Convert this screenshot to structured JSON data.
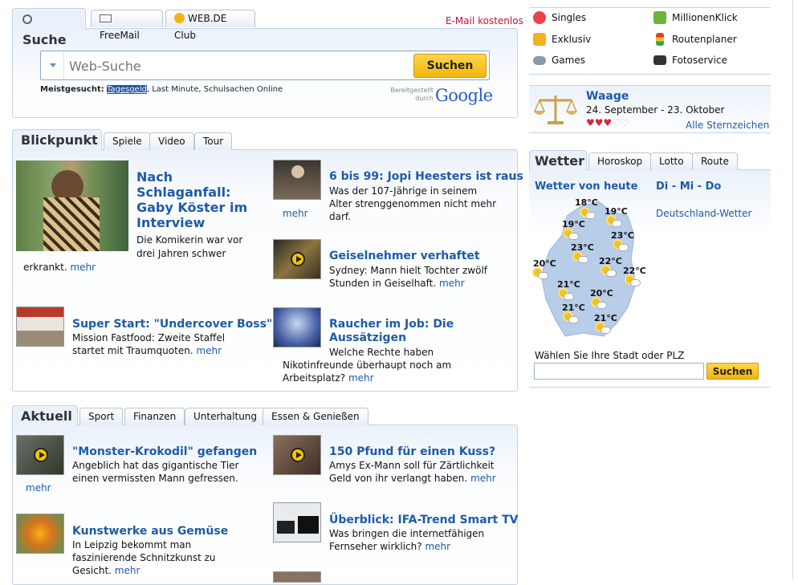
{
  "search": {
    "tabs": [
      {
        "label": "Suche"
      },
      {
        "label": "FreeMail"
      },
      {
        "label": "WEB.DE Club"
      }
    ],
    "email_link": "E-Mail kostenlos",
    "placeholder": "Web-Suche",
    "button": "Suchen",
    "meistgesucht_label": "Meistgesucht:",
    "meistgesucht_1": "Tagesgeld",
    "meistgesucht_rest": ", Last Minute, Schulsachen Online",
    "provided_by": "Bereitgestellt durch",
    "google": "Google"
  },
  "blickpunkt": {
    "tabs": [
      {
        "label": "Blickpunkt"
      },
      {
        "label": "Spiele"
      },
      {
        "label": "Video"
      },
      {
        "label": "Tour"
      }
    ],
    "lead": {
      "title": "Nach Schlaganfall: Gaby Köster im Interview",
      "text": "Die Komikerin war vor drei Jahren schwer",
      "text2": "erkrankt.",
      "more": "mehr"
    },
    "items": [
      {
        "title": "6 bis 99: Jopi Heesters ist raus",
        "text": "Was der 107-Jährige in seinem Alter strenggenommen nicht mehr darf.",
        "more": "mehr"
      },
      {
        "title": "Geiselnehmer verhaftet",
        "text": "Sydney: Mann hielt Tochter zwölf Stunden in Geiselhaft.",
        "more": "mehr"
      },
      {
        "title": "Super Start: \"Undercover Boss\"",
        "text": "Mission Fastfood: Zweite Staffel startet mit Traumquoten.",
        "more": "mehr"
      },
      {
        "title": "Raucher im Job: Die Aussätzigen",
        "text": "Welche Rechte haben Nikotinfreunde überhaupt noch am Arbeitsplatz?",
        "more": "mehr"
      }
    ]
  },
  "aktuell": {
    "tabs": [
      {
        "label": "Aktuell"
      },
      {
        "label": "Sport"
      },
      {
        "label": "Finanzen"
      },
      {
        "label": "Unterhaltung"
      },
      {
        "label": "Essen & Genießen"
      }
    ],
    "items": [
      {
        "title": "\"Monster-Krokodil\" gefangen",
        "text": "Angeblich hat das gigantische Tier einen vermissten Mann gefressen.",
        "more": "mehr"
      },
      {
        "title": "150 Pfund für einen Kuss?",
        "text": "Amys Ex-Mann soll für Zärtlichkeit Geld von ihr verlangt haben.",
        "more": "mehr"
      },
      {
        "title": "Kunstwerke aus Gemüse",
        "text": "In Leipzig bekommt man faszinierende Schnitzkunst zu Gesicht.",
        "more": "mehr"
      },
      {
        "title": "Überblick: IFA-Trend Smart TV",
        "text": "Was bringen die internetfähigen Fernseher wirklich?",
        "more": "mehr"
      }
    ]
  },
  "services": [
    {
      "label": "Singles",
      "icon": "heart-icon"
    },
    {
      "label": "MillionenKlick",
      "icon": "lottery-icon"
    },
    {
      "label": "Exklusiv",
      "icon": "tag-icon"
    },
    {
      "label": "Routenplaner",
      "icon": "traffic-light-icon"
    },
    {
      "label": "Games",
      "icon": "gamepad-icon"
    },
    {
      "label": "Fotoservice",
      "icon": "camera-icon"
    }
  ],
  "horoscope": {
    "sign": "Waage",
    "dates": "24. September - 23. Oktober",
    "rating": 3,
    "max": 5,
    "all_link": "Alle Sternzeichen"
  },
  "weather": {
    "tabs": [
      {
        "label": "Wetter"
      },
      {
        "label": "Horoskop"
      },
      {
        "label": "Lotto"
      },
      {
        "label": "Route"
      }
    ],
    "today": "Wetter von heute",
    "days": [
      "Di",
      "Mi",
      "Do"
    ],
    "germany_link": "Deutschland-Wetter",
    "temps": [
      "18°C",
      "19°C",
      "19°C",
      "23°C",
      "23°C",
      "20°C",
      "22°C",
      "22°C",
      "21°C",
      "20°C",
      "21°C",
      "21°C"
    ],
    "city_label": "Wählen Sie Ihre Stadt oder PLZ",
    "button": "Suchen"
  },
  "colors": {
    "link": "#1e5aa8",
    "email": "#c0103a",
    "button": "#f7c31b"
  }
}
